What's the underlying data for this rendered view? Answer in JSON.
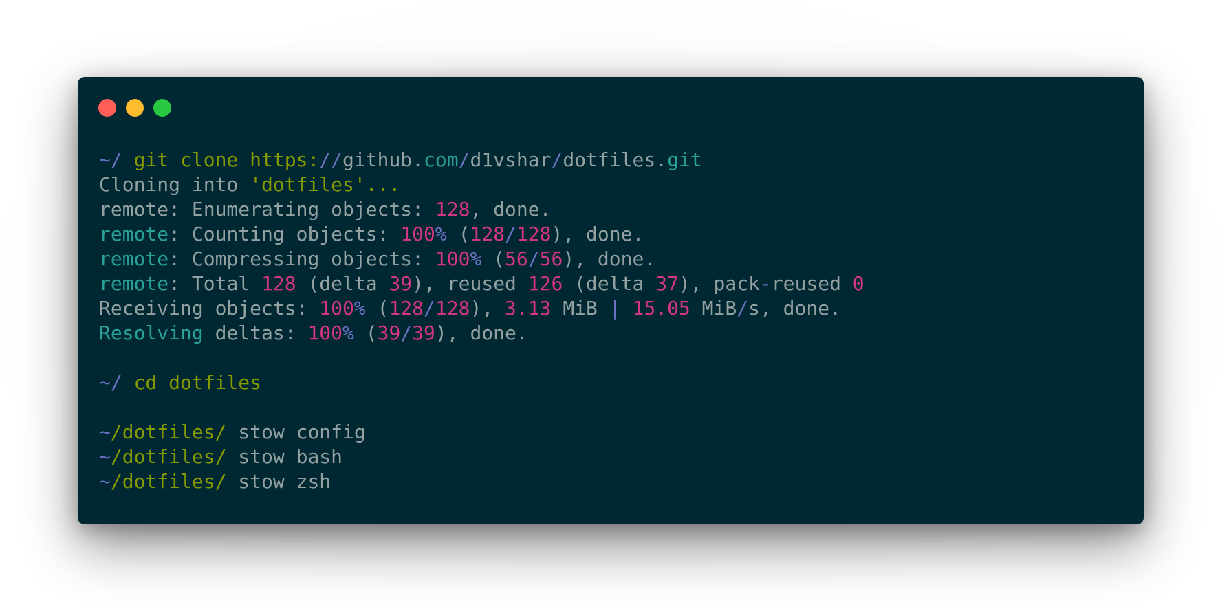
{
  "window": {
    "controls": [
      {
        "name": "close",
        "color": "#ff5f57"
      },
      {
        "name": "minimize",
        "color": "#febc2e"
      },
      {
        "name": "zoom",
        "color": "#28c840"
      }
    ]
  },
  "terminal": {
    "colors": {
      "background": "#002833",
      "text": "#93a1a1",
      "prompt": "#6c71c4",
      "command": "#859900",
      "cyan": "#2aa198",
      "number": "#d33682"
    },
    "lines": [
      [
        {
          "t": "~",
          "c": "prompt"
        },
        {
          "t": "/",
          "c": "prompt"
        },
        {
          "t": " git clone https:",
          "c": "cmd"
        },
        {
          "t": "//",
          "c": "op"
        },
        {
          "t": "github",
          "c": "plain"
        },
        {
          "t": ".",
          "c": "plain"
        },
        {
          "t": "com",
          "c": "cyan"
        },
        {
          "t": "/",
          "c": "op"
        },
        {
          "t": "d1vshar",
          "c": "plain"
        },
        {
          "t": "/",
          "c": "op"
        },
        {
          "t": "dotfiles",
          "c": "plain"
        },
        {
          "t": ".",
          "c": "plain"
        },
        {
          "t": "git",
          "c": "cyan"
        }
      ],
      [
        {
          "t": "Cloning into ",
          "c": "plain"
        },
        {
          "t": "'dotfiles'...",
          "c": "string"
        }
      ],
      [
        {
          "t": "remote: Enumerating objects: ",
          "c": "plain"
        },
        {
          "t": "128",
          "c": "num"
        },
        {
          "t": ", done.",
          "c": "plain"
        }
      ],
      [
        {
          "t": "remote",
          "c": "cyan"
        },
        {
          "t": ": Counting objects: ",
          "c": "plain"
        },
        {
          "t": "100",
          "c": "num"
        },
        {
          "t": "%",
          "c": "op"
        },
        {
          "t": " (",
          "c": "plain"
        },
        {
          "t": "128",
          "c": "num"
        },
        {
          "t": "/",
          "c": "op"
        },
        {
          "t": "128",
          "c": "num"
        },
        {
          "t": "), done.",
          "c": "plain"
        }
      ],
      [
        {
          "t": "remote",
          "c": "cyan"
        },
        {
          "t": ": Compressing objects: ",
          "c": "plain"
        },
        {
          "t": "100",
          "c": "num"
        },
        {
          "t": "%",
          "c": "op"
        },
        {
          "t": " (",
          "c": "plain"
        },
        {
          "t": "56",
          "c": "num"
        },
        {
          "t": "/",
          "c": "op"
        },
        {
          "t": "56",
          "c": "num"
        },
        {
          "t": "), done.",
          "c": "plain"
        }
      ],
      [
        {
          "t": "remote",
          "c": "cyan"
        },
        {
          "t": ": Total ",
          "c": "plain"
        },
        {
          "t": "128",
          "c": "num"
        },
        {
          "t": " (delta ",
          "c": "plain"
        },
        {
          "t": "39",
          "c": "num"
        },
        {
          "t": "), reused ",
          "c": "plain"
        },
        {
          "t": "126",
          "c": "num"
        },
        {
          "t": " (delta ",
          "c": "plain"
        },
        {
          "t": "37",
          "c": "num"
        },
        {
          "t": "), pack",
          "c": "plain"
        },
        {
          "t": "-",
          "c": "op"
        },
        {
          "t": "reused ",
          "c": "plain"
        },
        {
          "t": "0",
          "c": "num"
        }
      ],
      [
        {
          "t": "Receiving objects: ",
          "c": "plain"
        },
        {
          "t": "100",
          "c": "num"
        },
        {
          "t": "%",
          "c": "op"
        },
        {
          "t": " (",
          "c": "plain"
        },
        {
          "t": "128",
          "c": "num"
        },
        {
          "t": "/",
          "c": "op"
        },
        {
          "t": "128",
          "c": "num"
        },
        {
          "t": "), ",
          "c": "plain"
        },
        {
          "t": "3.13",
          "c": "num"
        },
        {
          "t": " MiB ",
          "c": "plain"
        },
        {
          "t": "|",
          "c": "op"
        },
        {
          "t": " ",
          "c": "plain"
        },
        {
          "t": "15.05",
          "c": "num"
        },
        {
          "t": " MiB",
          "c": "plain"
        },
        {
          "t": "/",
          "c": "op"
        },
        {
          "t": "s, done.",
          "c": "plain"
        }
      ],
      [
        {
          "t": "Resolving",
          "c": "cyan"
        },
        {
          "t": " deltas: ",
          "c": "plain"
        },
        {
          "t": "100",
          "c": "num"
        },
        {
          "t": "%",
          "c": "op"
        },
        {
          "t": " (",
          "c": "plain"
        },
        {
          "t": "39",
          "c": "num"
        },
        {
          "t": "/",
          "c": "op"
        },
        {
          "t": "39",
          "c": "num"
        },
        {
          "t": "), done.",
          "c": "plain"
        }
      ],
      [],
      [
        {
          "t": "~",
          "c": "prompt"
        },
        {
          "t": "/",
          "c": "prompt"
        },
        {
          "t": " cd dotfiles",
          "c": "cmd"
        }
      ],
      [],
      [
        {
          "t": "~",
          "c": "prompt"
        },
        {
          "t": "/dotfiles/",
          "c": "cmd"
        },
        {
          "t": " stow config",
          "c": "plain"
        }
      ],
      [
        {
          "t": "~",
          "c": "prompt"
        },
        {
          "t": "/dotfiles/",
          "c": "cmd"
        },
        {
          "t": " stow bash",
          "c": "plain"
        }
      ],
      [
        {
          "t": "~",
          "c": "prompt"
        },
        {
          "t": "/dotfiles/",
          "c": "cmd"
        },
        {
          "t": " stow zsh",
          "c": "plain"
        }
      ]
    ]
  }
}
